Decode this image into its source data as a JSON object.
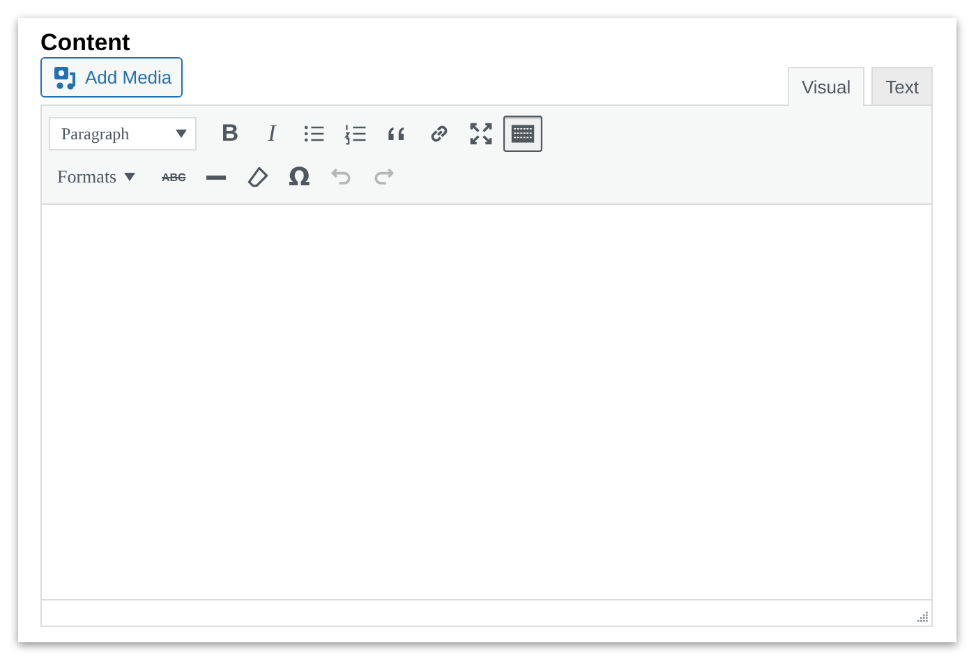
{
  "heading": "Content",
  "add_media": {
    "label": "Add Media"
  },
  "tabs": [
    {
      "label": "Visual",
      "selected": true
    },
    {
      "label": "Text",
      "selected": false
    }
  ],
  "toolbar_rows": [
    [
      {
        "kind": "select",
        "label": "Paragraph",
        "pressed": false,
        "disabled": false
      },
      {
        "kind": "glyph-bold",
        "label": "B",
        "pressed": false,
        "disabled": false
      },
      {
        "kind": "glyph-italic",
        "label": "I",
        "pressed": false,
        "disabled": false
      },
      {
        "kind": "bullet-list",
        "pressed": false,
        "disabled": false
      },
      {
        "kind": "numbered-list",
        "pressed": false,
        "disabled": false
      },
      {
        "kind": "quote",
        "pressed": false,
        "disabled": false
      },
      {
        "kind": "link",
        "pressed": false,
        "disabled": false
      },
      {
        "kind": "fullscreen",
        "pressed": false,
        "disabled": false
      },
      {
        "kind": "toolbar-toggle",
        "pressed": true,
        "disabled": false
      }
    ],
    [
      {
        "kind": "menu",
        "label": "Formats",
        "pressed": false,
        "disabled": false
      },
      {
        "kind": "glyph-strike",
        "label": "ABC",
        "pressed": false,
        "disabled": false
      },
      {
        "kind": "rule",
        "pressed": false,
        "disabled": false
      },
      {
        "kind": "eraser",
        "pressed": false,
        "disabled": false
      },
      {
        "kind": "glyph",
        "label": "Ω",
        "pressed": false,
        "disabled": false
      },
      {
        "kind": "undo",
        "pressed": false,
        "disabled": true
      },
      {
        "kind": "redo",
        "pressed": false,
        "disabled": true
      }
    ]
  ]
}
